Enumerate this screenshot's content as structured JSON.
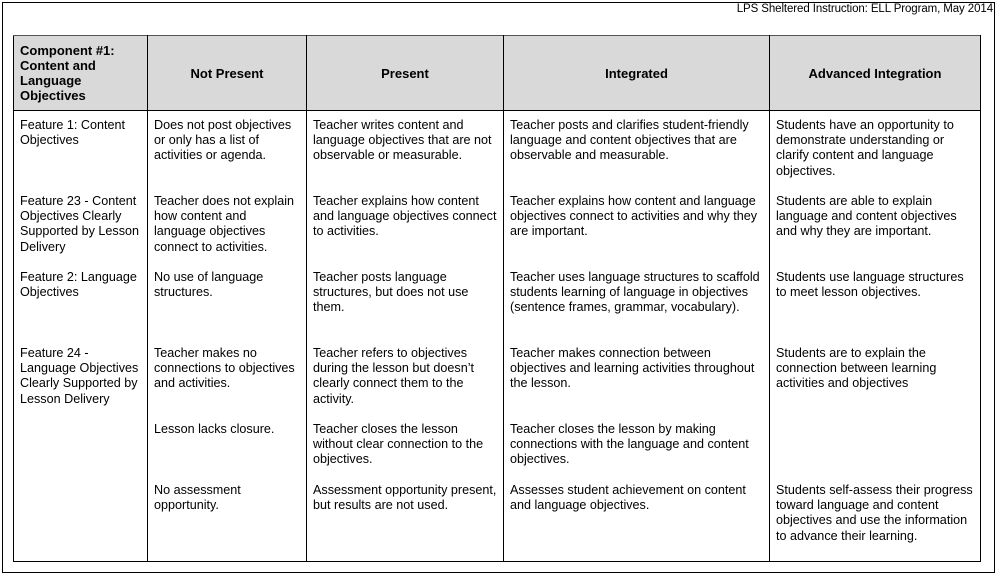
{
  "document": {
    "title": "LPS Sheltered Instruction:  ELL Program, May 2014"
  },
  "table": {
    "headers": [
      "Component #1: Content and Language Objectives",
      "Not Present",
      "Present",
      "Integrated",
      "Advanced Integration"
    ],
    "rows": [
      {
        "feature": "Feature 1: Content Objectives",
        "not_present": "Does not post objectives or only has a list of activities or agenda.",
        "present": "Teacher writes content and language objectives that are not observable or measurable.",
        "integrated": "Teacher posts and clarifies student-friendly language and content objectives that are observable and measurable.",
        "advanced": "Students have an opportunity to demonstrate understanding or clarify content and language objectives."
      },
      {
        "feature": "Feature 23 - Content Objectives Clearly Supported by Lesson Delivery",
        "not_present": "Teacher does not explain how content and language objectives connect to activities.",
        "present": "Teacher explains how content and language objectives connect to activities.",
        "integrated": "Teacher explains how content and language objectives connect to activities and why they are important.",
        "advanced": "Students are able to explain language and content objectives and why they are important."
      },
      {
        "feature": "Feature 2: Language Objectives",
        "not_present": "No use of language structures.",
        "present": "Teacher posts language structures, but does not use them.",
        "integrated": "Teacher uses language structures to scaffold students learning of language in objectives (sentence frames, grammar, vocabulary).",
        "advanced": "Students use language structures to meet lesson objectives."
      },
      {
        "feature": "Feature 24 - Language Objectives Clearly Supported by Lesson Delivery",
        "not_present": "Teacher makes no connections to objectives and activities.",
        "present": "Teacher refers to objectives during the lesson but doesn’t clearly connect them to the activity.",
        "integrated": "Teacher makes connection between objectives and learning activities throughout the lesson.",
        "advanced": "Students are to explain the connection between learning activities and objectives"
      },
      {
        "feature": "",
        "not_present": "Lesson lacks closure.",
        "present": "Teacher closes the lesson without clear connection to the objectives.",
        "integrated": "Teacher closes the lesson by making connections with the language and content objectives.",
        "advanced": ""
      },
      {
        "feature": "",
        "not_present": "No assessment opportunity.",
        "present": "Assessment opportunity present, but results are not used.",
        "integrated": "Assesses student achievement on content and language objectives.",
        "advanced": "Students self-assess their progress toward language and content objectives and use the information to advance their learning."
      }
    ]
  }
}
